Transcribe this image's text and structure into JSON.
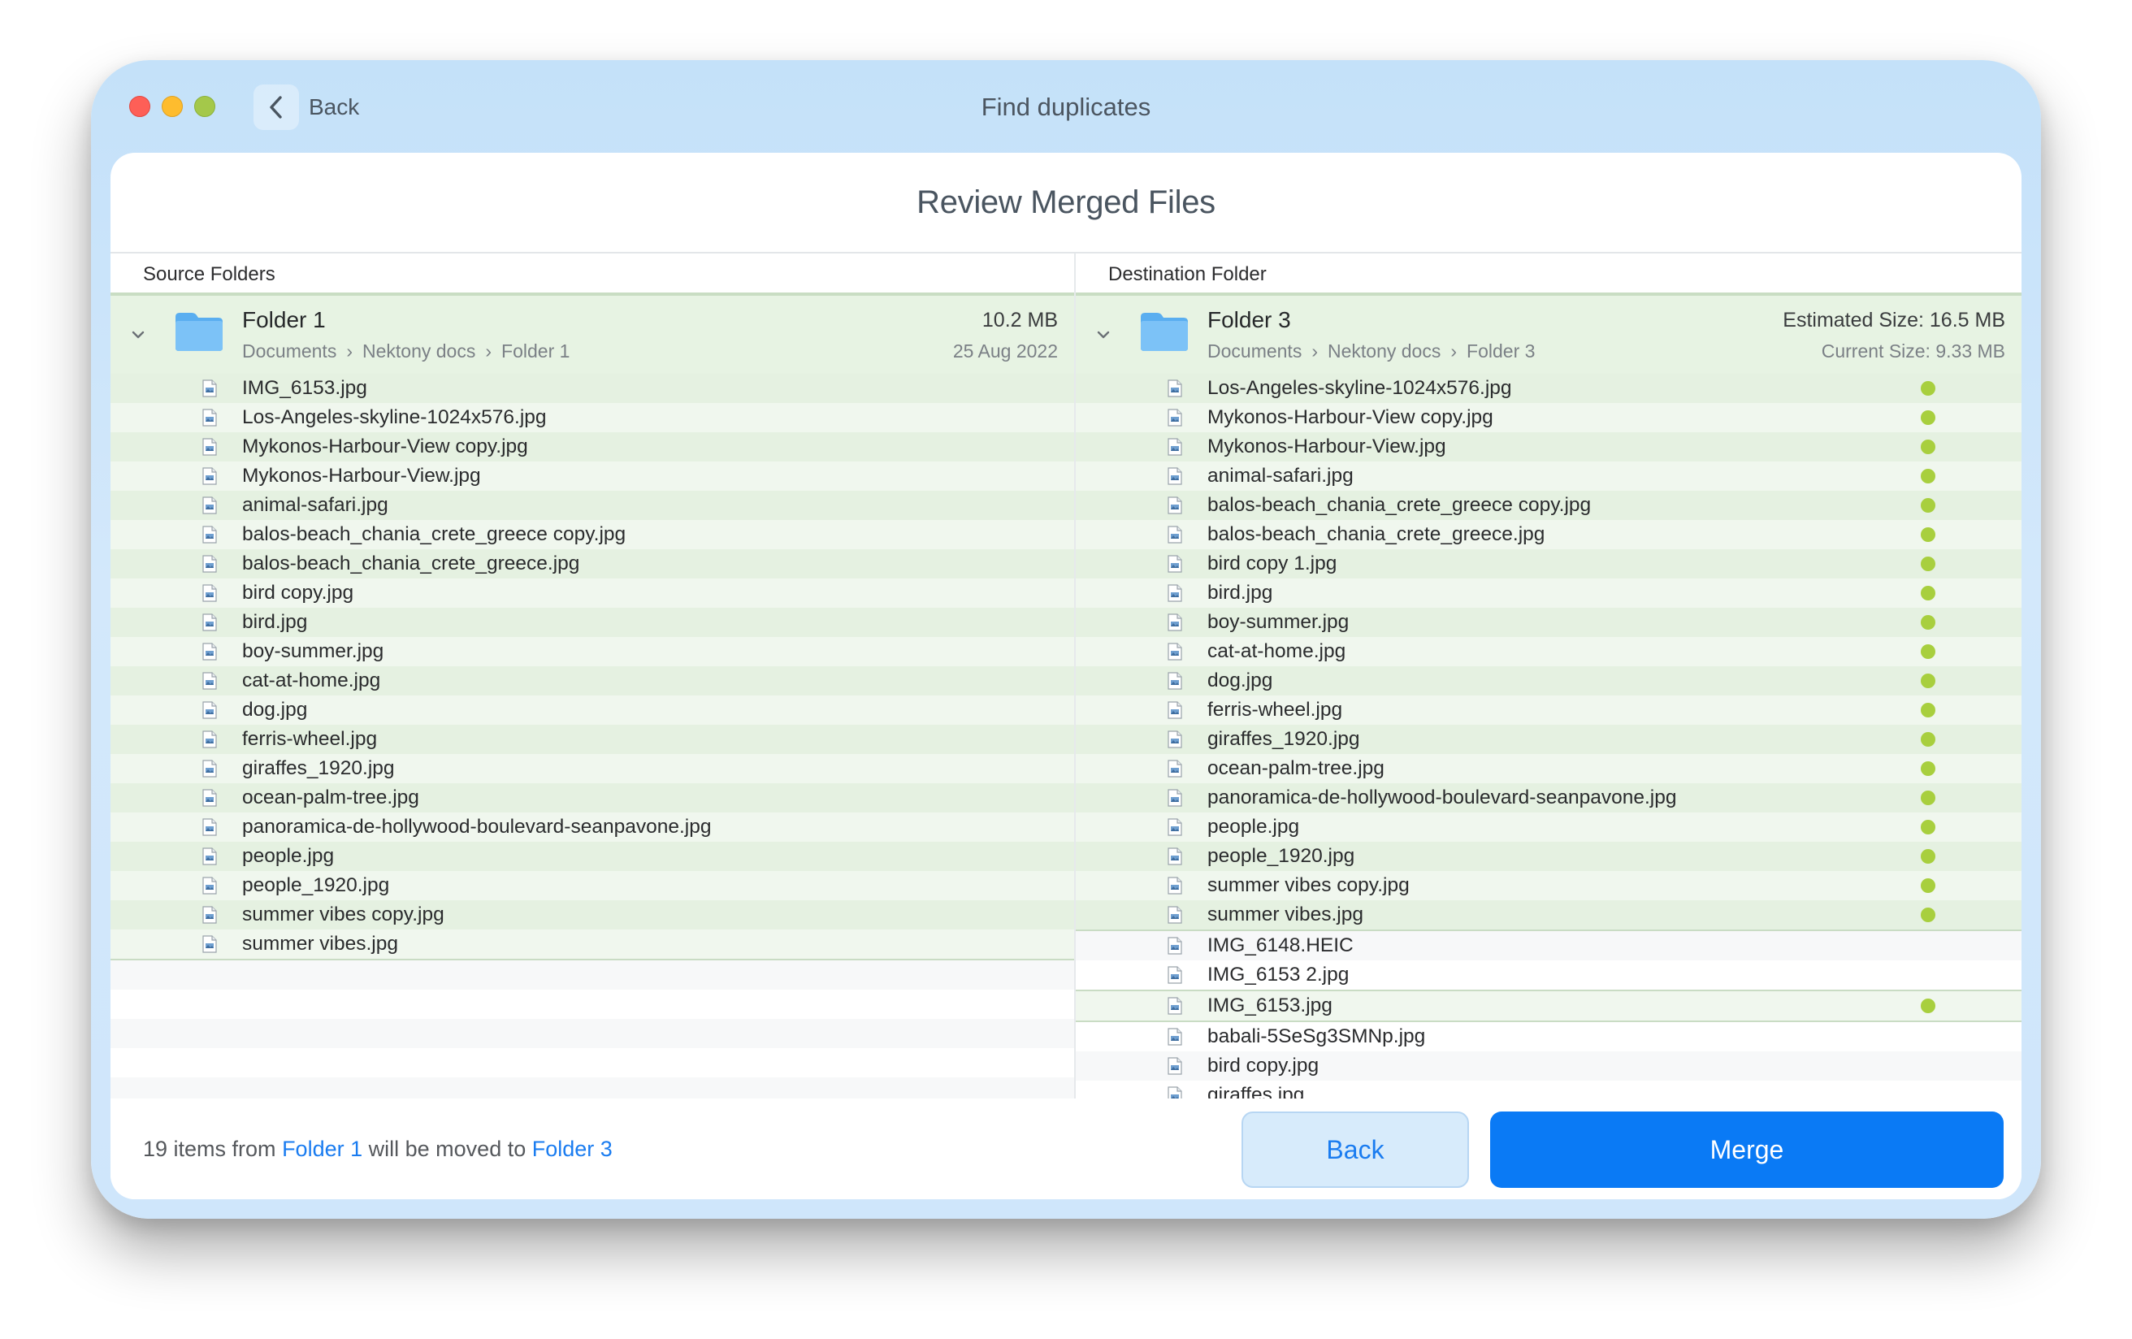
{
  "window": {
    "title": "Find duplicates",
    "back_label": "Back"
  },
  "panel": {
    "title": "Review Merged Files"
  },
  "source": {
    "header": "Source Folders",
    "folder": {
      "name": "Folder 1",
      "path": [
        "Documents",
        "Nektony docs",
        "Folder 1"
      ],
      "size": "10.2 MB",
      "date": "25 Aug 2022"
    },
    "files": [
      "IMG_6153.jpg",
      "Los-Angeles-skyline-1024x576.jpg",
      "Mykonos-Harbour-View copy.jpg",
      "Mykonos-Harbour-View.jpg",
      "animal-safari.jpg",
      "balos-beach_chania_crete_greece copy.jpg",
      "balos-beach_chania_crete_greece.jpg",
      "bird copy.jpg",
      "bird.jpg",
      "boy-summer.jpg",
      "cat-at-home.jpg",
      "dog.jpg",
      "ferris-wheel.jpg",
      "giraffes_1920.jpg",
      "ocean-palm-tree.jpg",
      "panoramica-de-hollywood-boulevard-seanpavone.jpg",
      "people.jpg",
      "people_1920.jpg",
      "summer vibes copy.jpg",
      "summer vibes.jpg"
    ]
  },
  "destination": {
    "header": "Destination Folder",
    "folder": {
      "name": "Folder 3",
      "path": [
        "Documents",
        "Nektony docs",
        "Folder 3"
      ],
      "estimated_size": "Estimated Size: 16.5 MB",
      "current_size": "Current Size: 9.33 MB"
    },
    "files": [
      {
        "name": "Los-Angeles-skyline-1024x576.jpg",
        "moved": true
      },
      {
        "name": "Mykonos-Harbour-View copy.jpg",
        "moved": true
      },
      {
        "name": "Mykonos-Harbour-View.jpg",
        "moved": true
      },
      {
        "name": "animal-safari.jpg",
        "moved": true
      },
      {
        "name": "balos-beach_chania_crete_greece copy.jpg",
        "moved": true
      },
      {
        "name": "balos-beach_chania_crete_greece.jpg",
        "moved": true
      },
      {
        "name": "bird copy 1.jpg",
        "moved": true
      },
      {
        "name": "bird.jpg",
        "moved": true
      },
      {
        "name": "boy-summer.jpg",
        "moved": true
      },
      {
        "name": "cat-at-home.jpg",
        "moved": true
      },
      {
        "name": "dog.jpg",
        "moved": true
      },
      {
        "name": "ferris-wheel.jpg",
        "moved": true
      },
      {
        "name": "giraffes_1920.jpg",
        "moved": true
      },
      {
        "name": "ocean-palm-tree.jpg",
        "moved": true
      },
      {
        "name": "panoramica-de-hollywood-boulevard-seanpavone.jpg",
        "moved": true
      },
      {
        "name": "people.jpg",
        "moved": true
      },
      {
        "name": "people_1920.jpg",
        "moved": true
      },
      {
        "name": "summer vibes copy.jpg",
        "moved": true
      },
      {
        "name": "summer vibes.jpg",
        "moved": true
      },
      {
        "name": "IMG_6148.HEIC",
        "moved": false
      },
      {
        "name": "IMG_6153 2.jpg",
        "moved": false
      },
      {
        "name": "IMG_6153.jpg",
        "moved": true
      },
      {
        "name": "babali-5SeSg3SMNp.jpg",
        "moved": false
      },
      {
        "name": "bird copy.jpg",
        "moved": false
      },
      {
        "name": "giraffes.jpg",
        "moved": false
      }
    ]
  },
  "footer": {
    "count_text": "19 items from",
    "source_link": "Folder 1",
    "middle_text": "will be moved to",
    "dest_link": "Folder 3",
    "back_button": "Back",
    "merge_button": "Merge"
  },
  "colors": {
    "accent": "#0a7af5",
    "moved_dot": "#a8cf3e",
    "moved_row": "#e7f3e3"
  }
}
